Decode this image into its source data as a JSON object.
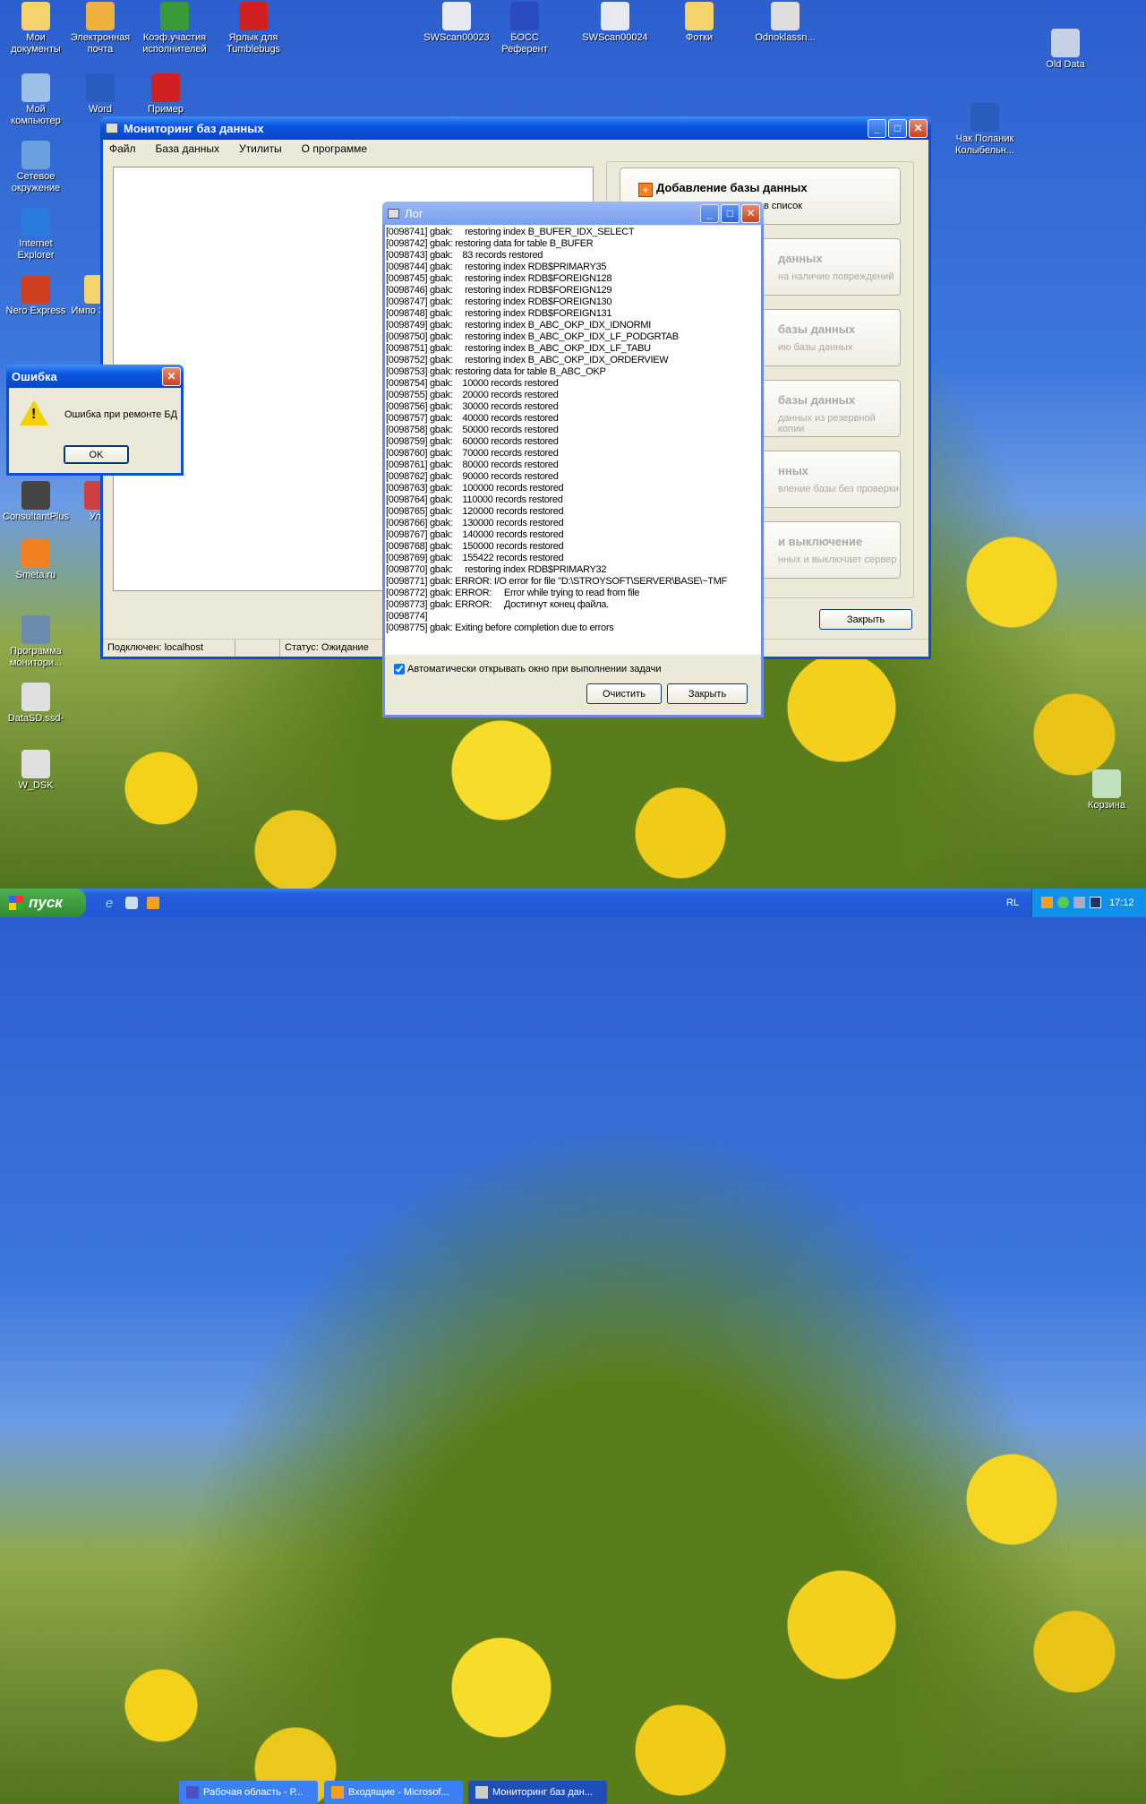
{
  "desktop_icons": [
    {
      "label": "Мои документы",
      "color": "#f5d36b"
    },
    {
      "label": "Электронная почта",
      "color": "#f0b040"
    },
    {
      "label": "Коэф.участия исполнителей",
      "color": "#3a9a3a"
    },
    {
      "label": "Ярлык для Tumblebugs",
      "color": "#d02020"
    },
    {
      "label": "SWScan00023",
      "color": "#e8e8f0"
    },
    {
      "label": "БОСС Референт",
      "color": "#2a4cc0"
    },
    {
      "label": "SWScan00024",
      "color": "#e8e8f0"
    },
    {
      "label": "Фотки",
      "color": "#f5d36b"
    },
    {
      "label": "Odnoklassn...",
      "color": "#dddddd"
    },
    {
      "label": "Old Data",
      "color": "#c8d0e8"
    },
    {
      "label": "Мой компьютер",
      "color": "#9cc0e8"
    },
    {
      "label": "Word",
      "color": "#2a5cc0"
    },
    {
      "label": "Пример",
      "color": "#d02020"
    },
    {
      "label": "Сетевое окружение",
      "color": "#6aa0e0"
    },
    {
      "label": "Internet Explorer",
      "color": "#2a7ce0"
    },
    {
      "label": "Nero Express",
      "color": "#d04020"
    },
    {
      "label": "Импо Экспо",
      "color": "#f5d36b"
    },
    {
      "label": "ConsultantPlus",
      "color": "#444444"
    },
    {
      "label": "Улы",
      "color": "#d04040"
    },
    {
      "label": "Smeta.ru",
      "color": "#f08020"
    },
    {
      "label": "Программа монитори...",
      "color": "#6a8ab0"
    },
    {
      "label": "DataSD.ssd-",
      "color": "#e0e0e0"
    },
    {
      "label": "W_DSK",
      "color": "#e0e0e0"
    },
    {
      "label": "Чак Поланик Колыбельн...",
      "color": "#2a5cc0"
    },
    {
      "label": "Корзина",
      "color": "#c0e0c0"
    }
  ],
  "main_window": {
    "title": "Мониторинг баз данных",
    "menu": [
      "Файл",
      "База данных",
      "Утилиты",
      "О программе"
    ],
    "actions": [
      {
        "title": "Добавление базы данных",
        "subtitle": "в список",
        "enabled": true
      },
      {
        "title": "данных",
        "subtitle": "на наличие повреждений",
        "enabled": false
      },
      {
        "title": "базы данных",
        "subtitle": "ию базы данных",
        "enabled": false
      },
      {
        "title": "базы данных",
        "subtitle": "данных из резервной копии",
        "enabled": false
      },
      {
        "title": "нных",
        "subtitle": "вление базы без проверки",
        "enabled": false
      },
      {
        "title": "и выключение",
        "subtitle": "нных и выключает сервер",
        "enabled": false
      }
    ],
    "close_label": "Закрыть",
    "status": {
      "connected": "Подключен: localhost",
      "state": "Статус: Ожидание"
    }
  },
  "log_window": {
    "title": "Лог",
    "lines": [
      "[0098741] gbak:     restoring index B_BUFER_IDX_SELECT",
      "[0098742] gbak: restoring data for table B_BUFER",
      "[0098743] gbak:    83 records restored",
      "[0098744] gbak:     restoring index RDB$PRIMARY35",
      "[0098745] gbak:     restoring index RDB$FOREIGN128",
      "[0098746] gbak:     restoring index RDB$FOREIGN129",
      "[0098747] gbak:     restoring index RDB$FOREIGN130",
      "[0098748] gbak:     restoring index RDB$FOREIGN131",
      "[0098749] gbak:     restoring index B_ABC_OKP_IDX_IDNORMI",
      "[0098750] gbak:     restoring index B_ABC_OKP_IDX_LF_PODGRTAB",
      "[0098751] gbak:     restoring index B_ABC_OKP_IDX_LF_TABU",
      "[0098752] gbak:     restoring index B_ABC_OKP_IDX_ORDERVIEW",
      "[0098753] gbak: restoring data for table B_ABC_OKP",
      "[0098754] gbak:    10000 records restored",
      "[0098755] gbak:    20000 records restored",
      "[0098756] gbak:    30000 records restored",
      "[0098757] gbak:    40000 records restored",
      "[0098758] gbak:    50000 records restored",
      "[0098759] gbak:    60000 records restored",
      "[0098760] gbak:    70000 records restored",
      "[0098761] gbak:    80000 records restored",
      "[0098762] gbak:    90000 records restored",
      "[0098763] gbak:    100000 records restored",
      "[0098764] gbak:    110000 records restored",
      "[0098765] gbak:    120000 records restored",
      "[0098766] gbak:    130000 records restored",
      "[0098767] gbak:    140000 records restored",
      "[0098768] gbak:    150000 records restored",
      "[0098769] gbak:    155422 records restored",
      "[0098770] gbak:     restoring index RDB$PRIMARY32",
      "[0098771] gbak: ERROR: I/O error for file \"D:\\STROYSOFT\\SERVER\\BASE\\~TMF",
      "[0098772] gbak: ERROR:     Error while trying to read from file",
      "[0098773] gbak: ERROR:     Достигнут конец файла.",
      "[0098774]",
      "[0098775] gbak: Exiting before completion due to errors"
    ],
    "auto_open_label": "Автоматически открывать окно при  выполнении задачи",
    "auto_open_checked": true,
    "clear_label": "Очистить",
    "close_label": "Закрыть"
  },
  "error_dialog": {
    "title": "Ошибка",
    "message": "Ошибка при ремонте БД",
    "ok_label": "OK"
  },
  "taskbar": {
    "start_label": "пуск",
    "tasks": [
      "Рабочая область - Р...",
      "Входящие - Microsof...",
      "Мониторинг баз дан..."
    ],
    "language": "RL",
    "clock": "17:12"
  }
}
